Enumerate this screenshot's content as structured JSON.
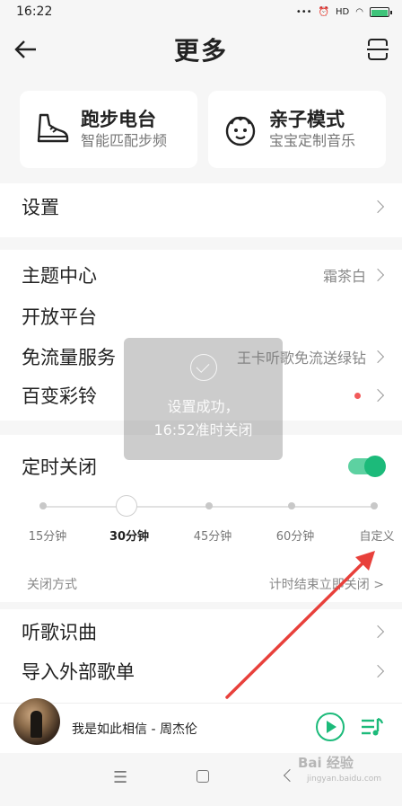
{
  "status_bar": {
    "time": "16:22",
    "signal_label": "HD",
    "battery_level": 1.0
  },
  "header": {
    "title": "更多"
  },
  "cards": [
    {
      "title": "跑步电台",
      "subtitle": "智能匹配步频",
      "icon": "running-shoe-icon"
    },
    {
      "title": "亲子模式",
      "subtitle": "宝宝定制音乐",
      "icon": "baby-face-icon"
    }
  ],
  "settings": {
    "label": "设置"
  },
  "list": [
    {
      "label": "主题中心",
      "value": "霜茶白"
    },
    {
      "label": "开放平台",
      "value": ""
    },
    {
      "label": "免流量服务",
      "value": "王卡听歌免流送绿钻"
    },
    {
      "label": "百变彩铃",
      "value": ""
    }
  ],
  "timer": {
    "label": "定时关闭",
    "enabled": true,
    "options": [
      "15分钟",
      "30分钟",
      "45分钟",
      "60分钟",
      "自定义"
    ],
    "selected_index": 1,
    "close_mode_label": "关闭方式",
    "close_mode_value": "计时结束立即关闭 >"
  },
  "more_list": [
    {
      "label": "听歌识曲"
    },
    {
      "label": "导入外部歌单"
    }
  ],
  "toast": {
    "line1": "设置成功，",
    "line2": "16:52准时关闭"
  },
  "player": {
    "song": "我是如此相信 - 周杰伦"
  },
  "watermark": {
    "text": "Bai 经验",
    "sub": "jingyan.baidu.com"
  },
  "colors": {
    "accent": "#1cba7a",
    "badge": "#f25a5a",
    "annotation_arrow": "#e8403b"
  }
}
